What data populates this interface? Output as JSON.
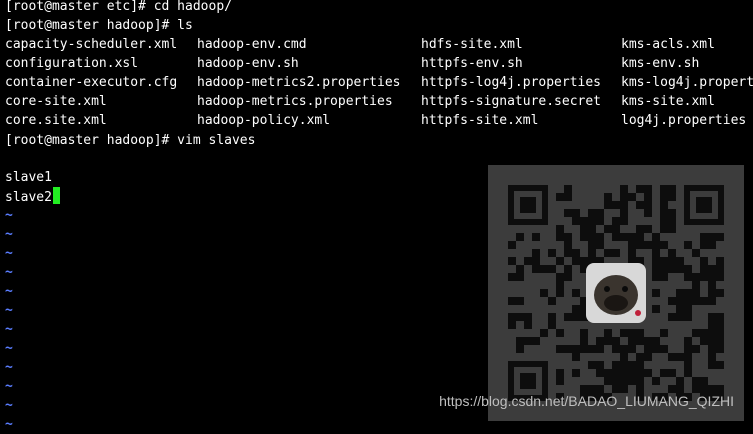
{
  "terminal": {
    "prompt_lines": [
      "[root@master etc]# cd hadoop/",
      "[root@master hadoop]# ls"
    ],
    "ls_rows": [
      [
        "capacity-scheduler.xml",
        "hadoop-env.cmd",
        "hdfs-site.xml",
        "kms-acls.xml"
      ],
      [
        "configuration.xsl",
        "hadoop-env.sh",
        "httpfs-env.sh",
        "kms-env.sh"
      ],
      [
        "container-executor.cfg",
        "hadoop-metrics2.properties",
        "httpfs-log4j.properties",
        "kms-log4j.propert"
      ],
      [
        "core-site.xml",
        "hadoop-metrics.properties",
        "httpfs-signature.secret",
        "kms-site.xml"
      ],
      [
        "core.site.xml",
        "hadoop-policy.xml",
        "httpfs-site.xml",
        "log4j.properties"
      ]
    ],
    "vim_command": "[root@master hadoop]# vim slaves",
    "file_lines": [
      "slave1",
      "slave2"
    ],
    "tilde_char": "~",
    "tilde_count": 12,
    "colors": {
      "background": "#000000",
      "text": "#ffffff",
      "tilde": "#5a7dff",
      "cursor": "#22ee22"
    }
  },
  "overlay": {
    "qr_code_icon": "qr-code-icon",
    "avatar_icon": "pug-dog-avatar-icon",
    "watermark": "https://blog.csdn.net/BADAO_LIUMANG_QIZHI"
  }
}
